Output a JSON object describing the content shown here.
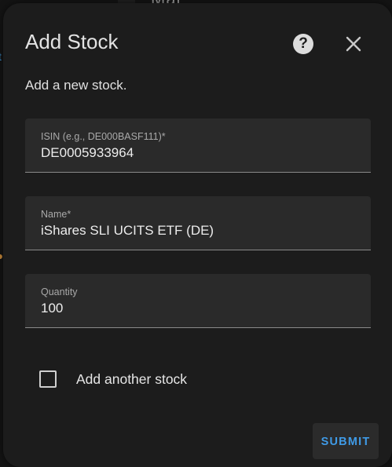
{
  "background": {
    "partial_heading": "Mal",
    "partial_link": "t"
  },
  "dialog": {
    "title": "Add Stock",
    "subtitle": "Add a new stock.",
    "help_icon": "help-circle-icon",
    "help_glyph": "?",
    "close_icon": "close-icon"
  },
  "form": {
    "isin": {
      "label": "ISIN (e.g., DE000BASF111)*",
      "value": "DE0005933964"
    },
    "name": {
      "label": "Name*",
      "value": "iShares SLI UCITS ETF (DE)"
    },
    "quantity": {
      "label": "Quantity",
      "value": "100"
    },
    "add_another": {
      "label": "Add another stock",
      "checked": false
    }
  },
  "actions": {
    "submit_label": "SUBMIT"
  },
  "colors": {
    "surface": "#1c1c1c",
    "field_fill": "#2a2a2a",
    "accent": "#3f9ae6",
    "text": "#e3e3e3"
  }
}
